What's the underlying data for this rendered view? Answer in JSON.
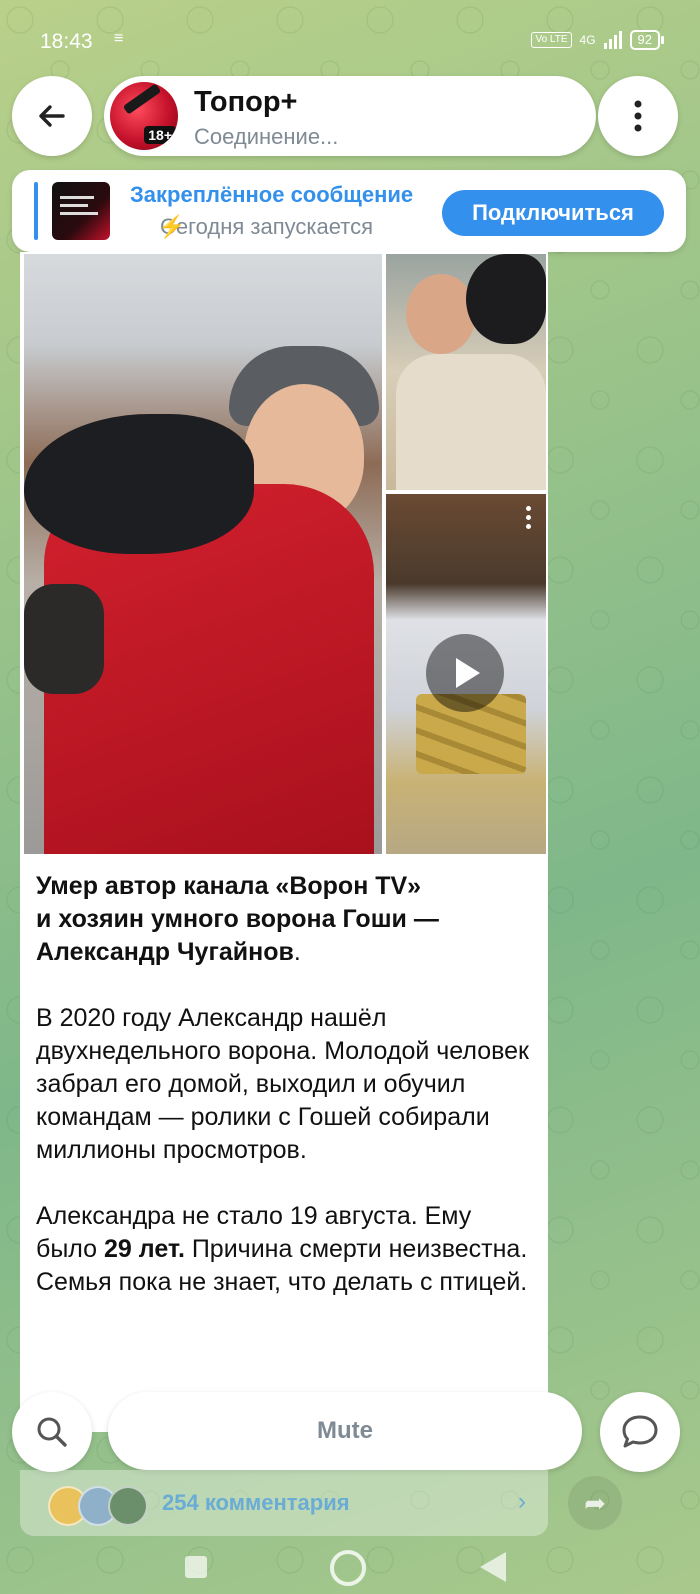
{
  "status_bar": {
    "time": "18:43",
    "network": "4G",
    "lte": "Vo LTE",
    "battery": "92"
  },
  "header": {
    "channel_name": "Топор+",
    "status": "Соединение...",
    "avatar_badge": "18+"
  },
  "pinned": {
    "title": "Закреплённое сообщение",
    "text": "Сегодня запускается",
    "action_label": "Подключиться"
  },
  "post": {
    "headline_1": "Умер автор канала «Ворон TV»",
    "headline_2": "и хозяин умного ворона Гоши —",
    "headline_3": "Александр Чугайнов",
    "headline_end": ".",
    "para1": "В 2020 году Александр нашёл двухнедельного ворона. Молодой человек забрал его домой, выходил и обучил командам — ролики с Гошей собирали миллионы просмотров.",
    "para2_a": "Александра не стало 19 августа. Ему было ",
    "para2_bold": "29 лет.",
    "para2_b": " Причина смерти неизвестна. Семья пока не знает, что делать с птицей."
  },
  "bottom": {
    "mute_label": "Mute",
    "comments_label": "254 комментария"
  },
  "colors": {
    "accent": "#3390ec",
    "secondary_text": "#7f8a94"
  }
}
